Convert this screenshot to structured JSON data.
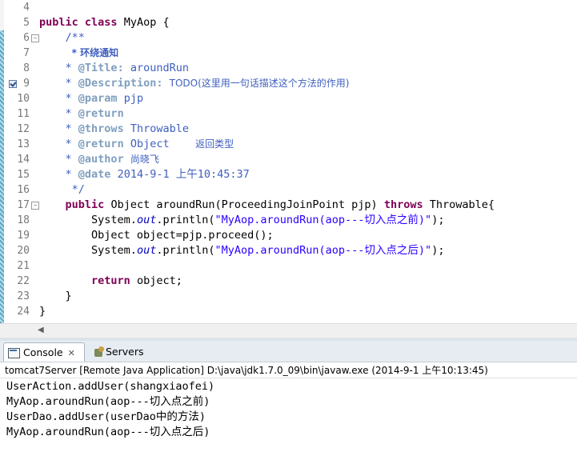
{
  "editor": {
    "lines": [
      {
        "n": "4",
        "text": ""
      },
      {
        "n": "5",
        "text": "public class MyAop {"
      },
      {
        "n": "6",
        "text": "    /**"
      },
      {
        "n": "7",
        "text": "     * 环绕通知"
      },
      {
        "n": "8",
        "text": "    * @Title: aroundRun"
      },
      {
        "n": "9",
        "text": "    * @Description: TODO(这里用一句话描述这个方法的作用)"
      },
      {
        "n": "10",
        "text": "    * @param pjp"
      },
      {
        "n": "11",
        "text": "    * @return"
      },
      {
        "n": "12",
        "text": "    * @throws Throwable"
      },
      {
        "n": "13",
        "text": "    * @return Object    返回类型"
      },
      {
        "n": "14",
        "text": "    * @author 尚晓飞"
      },
      {
        "n": "15",
        "text": "    * @date 2014-9-1 上午10:45:37"
      },
      {
        "n": "16",
        "text": "     */"
      },
      {
        "n": "17",
        "text": "    public Object aroundRun(ProceedingJoinPoint pjp) throws Throwable{"
      },
      {
        "n": "18",
        "text": "        System.out.println(\"MyAop.aroundRun(aop---切入点之前)\");"
      },
      {
        "n": "19",
        "text": "        Object object=pjp.proceed();"
      },
      {
        "n": "20",
        "text": "        System.out.println(\"MyAop.aroundRun(aop---切入点之后)\");"
      },
      {
        "n": "21",
        "text": ""
      },
      {
        "n": "22",
        "text": "        return object;"
      },
      {
        "n": "23",
        "text": "    }"
      },
      {
        "n": "24",
        "text": "}"
      }
    ],
    "tokens": {
      "public": "public",
      "class": "class",
      "classname": "MyAop {",
      "jd_open": "/**",
      "jd_line7": "* 环绕通知",
      "star": "*",
      "title_tag": "@Title:",
      "title_val": "aroundRun",
      "desc_tag": "@Description:",
      "desc_val": "TODO(这里用一句话描述这个方法的作用)",
      "param_tag": "@param",
      "param_val": "pjp",
      "return_tag": "@return",
      "throws_tag": "@throws",
      "throws_val": "Throwable",
      "return_val": "Object",
      "return_desc": "返回类型",
      "author_tag": "@author",
      "author_val": "尚晓飞",
      "date_tag": "@date",
      "date_val": "2014-9-1 上午10:45:37",
      "jd_close": "*/",
      "sig_ret": "Object aroundRun(ProceedingJoinPoint pjp)",
      "throws_kw": "throws",
      "sig_end": "Throwable{",
      "sys": "System.",
      "out": "out",
      "println": ".println(",
      "str_before": "\"MyAop.aroundRun(aop---切入点之前)\"",
      "str_after": "\"MyAop.aroundRun(aop---切入点之后)\"",
      "end_stmt": ");",
      "line19": "Object object=pjp.proceed();",
      "return_kw": "return",
      "return_rest": " object;",
      "close_brace_in": "}",
      "close_brace_out": "}"
    }
  },
  "console": {
    "tabs": [
      {
        "label": "Console"
      },
      {
        "label": "Servers"
      }
    ],
    "close_glyph": "✕",
    "status": "tomcat7Server [Remote Java Application] D:\\java\\jdk1.7.0_09\\bin\\javaw.exe (2014-9-1 上午10:13:45)",
    "output": [
      "UserAction.addUser(shangxiaofei)",
      "MyAop.aroundRun(aop---切入点之前)",
      "UserDao.addUser(userDao中的方法)",
      "MyAop.aroundRun(aop---切入点之后)"
    ]
  }
}
